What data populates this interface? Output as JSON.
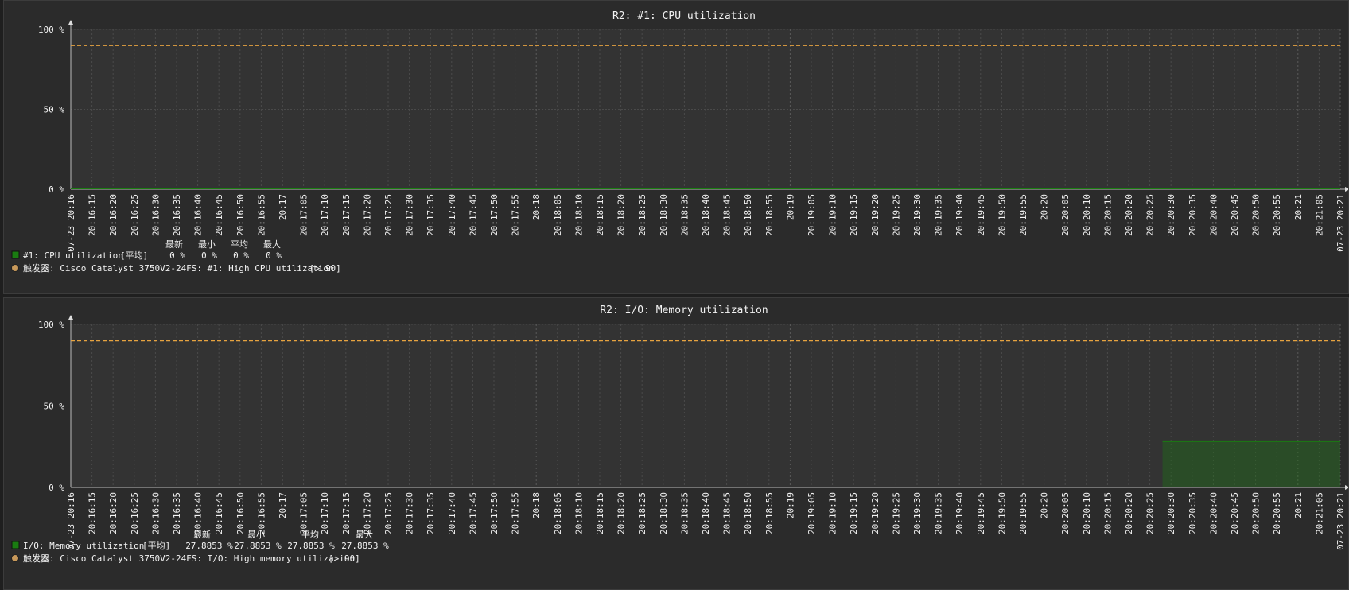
{
  "charts": [
    {
      "id": "cpu",
      "title": "R2: #1: CPU utilization",
      "y_ticks": [
        "100 %",
        "50 %",
        "0 %"
      ],
      "legend_headers": [
        "最新",
        "最小",
        "平均",
        "最大"
      ],
      "item": {
        "name": "#1: CPU utilization",
        "func": "[平均]",
        "values": [
          "0 %",
          "0 %",
          "0 %",
          "0 %"
        ],
        "color": "#1a7c11"
      },
      "trigger": {
        "label": "触发器: Cisco Catalyst 3750V2-24FS: #1: High CPU utilization",
        "cond": "[> 90]",
        "color": "#c8995a"
      }
    },
    {
      "id": "mem",
      "title": "R2: I/O: Memory utilization",
      "y_ticks": [
        "100 %",
        "50 %",
        "0 %"
      ],
      "legend_headers": [
        "最新",
        "最小",
        "平均",
        "最大"
      ],
      "item": {
        "name": "I/O: Memory utilization",
        "func": "[平均]",
        "values": [
          "27.8853 %",
          "27.8853 %",
          "27.8853 %",
          "27.8853 %"
        ],
        "color": "#1a7c11"
      },
      "trigger": {
        "label": "触发器: Cisco Catalyst 3750V2-24FS: I/O: High memory utilization",
        "cond": "[> 90]",
        "color": "#c8995a"
      }
    }
  ],
  "x_labels": [
    {
      "t": "07-23 20:16",
      "major": true
    },
    {
      "t": "20:16:15"
    },
    {
      "t": "20:16:20"
    },
    {
      "t": "20:16:25"
    },
    {
      "t": "20:16:30"
    },
    {
      "t": "20:16:35"
    },
    {
      "t": "20:16:40"
    },
    {
      "t": "20:16:45"
    },
    {
      "t": "20:16:50"
    },
    {
      "t": "20:16:55"
    },
    {
      "t": "20:17",
      "major": true
    },
    {
      "t": "20:17:05"
    },
    {
      "t": "20:17:10"
    },
    {
      "t": "20:17:15"
    },
    {
      "t": "20:17:20"
    },
    {
      "t": "20:17:25"
    },
    {
      "t": "20:17:30"
    },
    {
      "t": "20:17:35"
    },
    {
      "t": "20:17:40"
    },
    {
      "t": "20:17:45"
    },
    {
      "t": "20:17:50"
    },
    {
      "t": "20:17:55"
    },
    {
      "t": "20:18",
      "major": true
    },
    {
      "t": "20:18:05"
    },
    {
      "t": "20:18:10"
    },
    {
      "t": "20:18:15"
    },
    {
      "t": "20:18:20"
    },
    {
      "t": "20:18:25"
    },
    {
      "t": "20:18:30"
    },
    {
      "t": "20:18:35"
    },
    {
      "t": "20:18:40"
    },
    {
      "t": "20:18:45"
    },
    {
      "t": "20:18:50"
    },
    {
      "t": "20:18:55"
    },
    {
      "t": "20:19",
      "major": true
    },
    {
      "t": "20:19:05"
    },
    {
      "t": "20:19:10"
    },
    {
      "t": "20:19:15"
    },
    {
      "t": "20:19:20"
    },
    {
      "t": "20:19:25"
    },
    {
      "t": "20:19:30"
    },
    {
      "t": "20:19:35"
    },
    {
      "t": "20:19:40"
    },
    {
      "t": "20:19:45"
    },
    {
      "t": "20:19:50"
    },
    {
      "t": "20:19:55"
    },
    {
      "t": "20:20",
      "major": true
    },
    {
      "t": "20:20:05"
    },
    {
      "t": "20:20:10"
    },
    {
      "t": "20:20:15"
    },
    {
      "t": "20:20:20"
    },
    {
      "t": "20:20:25"
    },
    {
      "t": "20:20:30"
    },
    {
      "t": "20:20:35"
    },
    {
      "t": "20:20:40"
    },
    {
      "t": "20:20:45"
    },
    {
      "t": "20:20:50"
    },
    {
      "t": "20:20:55"
    },
    {
      "t": "20:21",
      "major": true
    },
    {
      "t": "20:21:05"
    },
    {
      "t": "07-23 20:21",
      "major": true
    }
  ],
  "chart_data": [
    {
      "type": "area",
      "title": "R2: #1: CPU utilization",
      "ylim": [
        0,
        100
      ],
      "x_range": [
        "07-23 20:16:10",
        "07-23 20:21:10"
      ],
      "threshold": 90,
      "series": [
        {
          "name": "#1: CPU utilization",
          "color": "#1a7c11",
          "points": [
            [
              "20:16:10",
              0
            ],
            [
              "20:21:10",
              0
            ]
          ]
        }
      ]
    },
    {
      "type": "area",
      "title": "R2: I/O: Memory utilization",
      "ylim": [
        0,
        100
      ],
      "x_range": [
        "07-23 20:16:10",
        "07-23 20:21:10"
      ],
      "threshold": 90,
      "series": [
        {
          "name": "I/O: Memory utilization",
          "color": "#1a7c11",
          "points": [
            [
              "20:20:28",
              27.8853
            ],
            [
              "20:21:10",
              27.8853
            ]
          ]
        }
      ]
    }
  ],
  "colors": {
    "panel_bg": "#2b2b2b",
    "plot_bg": "#333333",
    "grid": "#4a4a4a",
    "threshold": "#e6a340",
    "major_label": "#e05050",
    "text": "#f2f2f2"
  }
}
